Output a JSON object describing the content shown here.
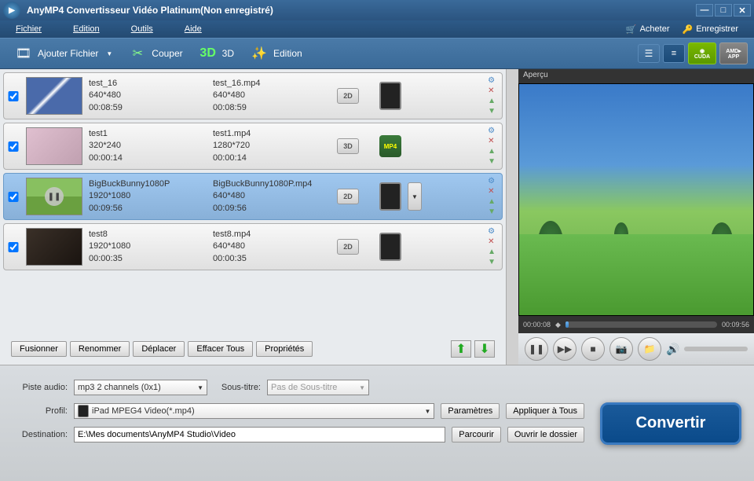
{
  "window": {
    "title": "AnyMP4 Convertisseur Vidéo Platinum(Non enregistré)"
  },
  "menubar": {
    "items": [
      "Fichier",
      "Edition",
      "Outils",
      "Aide"
    ],
    "buy": "Acheter",
    "register": "Enregistrer"
  },
  "toolbar": {
    "add_file": "Ajouter Fichier",
    "cut": "Couper",
    "three_d": "3D",
    "edit": "Edition",
    "gpu_nv": "CUDA",
    "gpu_amd": "AMD APP"
  },
  "list": [
    {
      "name": "test_16",
      "res": "640*480",
      "dur": "00:08:59",
      "out_name": "test_16.mp4",
      "out_res": "640*480",
      "out_dur": "00:08:59",
      "badge": "2D",
      "device": true,
      "selected": false
    },
    {
      "name": "test1",
      "res": "320*240",
      "dur": "00:00:14",
      "out_name": "test1.mp4",
      "out_res": "1280*720",
      "out_dur": "00:00:14",
      "badge": "3D",
      "device": false,
      "selected": false
    },
    {
      "name": "BigBuckBunny1080P",
      "res": "1920*1080",
      "dur": "00:09:56",
      "out_name": "BigBuckBunny1080P.mp4",
      "out_res": "640*480",
      "out_dur": "00:09:56",
      "badge": "2D",
      "device": true,
      "selected": true
    },
    {
      "name": "test8",
      "res": "1920*1080",
      "dur": "00:00:35",
      "out_name": "test8.mp4",
      "out_res": "640*480",
      "out_dur": "00:00:35",
      "badge": "2D",
      "device": true,
      "selected": false
    }
  ],
  "list_footer": {
    "merge": "Fusionner",
    "rename": "Renommer",
    "move": "Déplacer",
    "clear_all": "Effacer Tous",
    "properties": "Propriétés"
  },
  "preview": {
    "title": "Aperçu",
    "current": "00:00:08",
    "total": "00:09:56"
  },
  "params": {
    "audio_label": "Piste audio:",
    "audio_value": "mp3 2 channels (0x1)",
    "subtitle_label": "Sous-titre:",
    "subtitle_value": "Pas de Sous-titre",
    "profile_label": "Profil:",
    "profile_value": "iPad MPEG4 Video(*.mp4)",
    "settings": "Paramètres",
    "apply_all": "Appliquer à Tous",
    "dest_label": "Destination:",
    "dest_value": "E:\\Mes documents\\AnyMP4 Studio\\Video",
    "browse": "Parcourir",
    "open_folder": "Ouvrir le dossier"
  },
  "convert": "Convertir"
}
